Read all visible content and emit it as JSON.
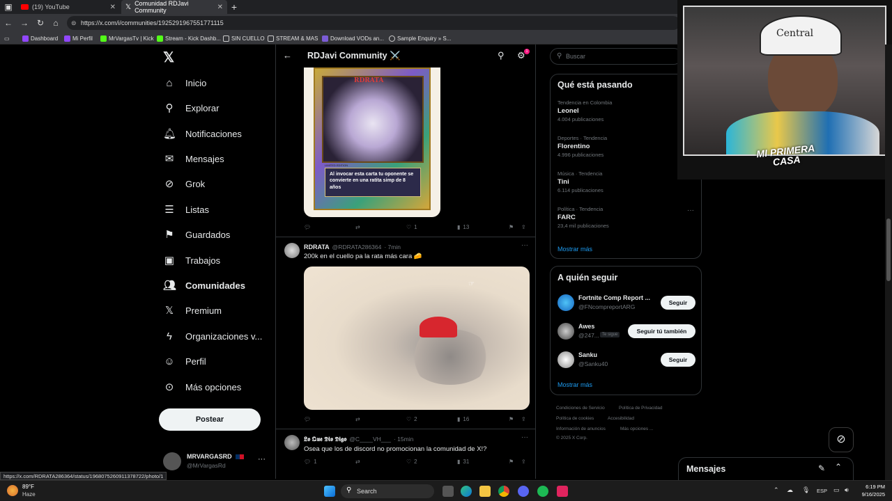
{
  "browser": {
    "tabs": [
      {
        "label": "(19) YouTube"
      },
      {
        "label": "Comunidad RDJavi Community"
      }
    ],
    "url": "https://x.com/i/communities/1925291967551771115",
    "bookmarks": [
      "Dashboard",
      "Mi Perfil",
      "MrVargasTv | Kick",
      "Stream - Kick Dashb...",
      "SIN CUELLO",
      "STREAM & MAS",
      "Download VODs an...",
      "Sample Enquiry » S..."
    ]
  },
  "nav": {
    "items": [
      {
        "label": "Inicio",
        "icon": "home-icon"
      },
      {
        "label": "Explorar",
        "icon": "search-icon"
      },
      {
        "label": "Notificaciones",
        "icon": "bell-icon"
      },
      {
        "label": "Mensajes",
        "icon": "envelope-icon"
      },
      {
        "label": "Grok",
        "icon": "grok-icon"
      },
      {
        "label": "Listas",
        "icon": "list-icon"
      },
      {
        "label": "Guardados",
        "icon": "bookmark-icon"
      },
      {
        "label": "Trabajos",
        "icon": "briefcase-icon"
      },
      {
        "label": "Comunidades",
        "icon": "people-icon"
      },
      {
        "label": "Premium",
        "icon": "x-icon"
      },
      {
        "label": "Organizaciones v...",
        "icon": "lightning-icon"
      },
      {
        "label": "Perfil",
        "icon": "person-icon"
      },
      {
        "label": "Más opciones",
        "icon": "more-circle-icon"
      }
    ],
    "post_label": "Postear",
    "account": {
      "name": "MRVARGASRD",
      "handle": "@MrVargasRd"
    }
  },
  "community": {
    "title": "RDJavi Community ⚔️",
    "notification_count": "1"
  },
  "tweets": [
    {
      "card_caption": "Al invocar esta carta tu oponente se convierte en una ratita simp de 8 años",
      "card_title": "RDRATA",
      "card_edition": "LIMITED EDITION",
      "likes": "1",
      "views": "13"
    },
    {
      "name": "RDRATA",
      "handle": "@RDRATA286364",
      "time": "· 7min",
      "text": "200k en el cuello pa la rata más cara 🧀",
      "likes": "2",
      "views": "16"
    },
    {
      "name": "𝕷𝖔 𝕼𝖚𝖊 𝕯𝖎𝖔 𝕯𝖎𝖌𝖔",
      "handle": "@C____VH___",
      "time": "· 15min",
      "text": "Osea que los de discord no promocionan la comunidad de X!?",
      "replies": "1",
      "likes": "2",
      "views": "31"
    }
  ],
  "right": {
    "search_placeholder": "Buscar",
    "trends_title": "Qué está pasando",
    "trends": [
      {
        "meta": "Tendencia en Colombia",
        "name": "Leonel",
        "count": "4.004 publicaciones"
      },
      {
        "meta": "Deportes · Tendencia",
        "name": "Florentino",
        "count": "4.996 publicaciones"
      },
      {
        "meta": "Música · Tendencia",
        "name": "Tini",
        "count": "6.114 publicaciones"
      },
      {
        "meta": "Política · Tendencia",
        "name": "FARC",
        "count": "23,4 mil publicaciones"
      }
    ],
    "show_more": "Mostrar más",
    "follow_title": "A quién seguir",
    "follow": [
      {
        "name": "Fortnite Comp Report ...",
        "handle": "@FNcompreportARG",
        "button": "Seguir"
      },
      {
        "name": "Awes",
        "handle": "@247...",
        "badge": "Te sigue",
        "button": "Seguir tú también"
      },
      {
        "name": "Sanku",
        "handle": "@Sanku40",
        "button": "Seguir"
      }
    ],
    "footer": [
      "Condiciones de Servicio",
      "Política de Privacidad",
      "Política de cookies",
      "Accesibilidad",
      "Información de anuncios",
      "Más opciones ...",
      "© 2025 X Corp."
    ]
  },
  "messages_label": "Mensajes",
  "overlay": {
    "cap_text": "Central",
    "brand_text": "MI PRIMERA CASA"
  },
  "status_link": "https://x.com/RDRATA286364/status/1968075260911378722/photo/1",
  "taskbar": {
    "weather_temp": "89°F",
    "weather_desc": "Haze",
    "search": "Search",
    "lang": "ESP",
    "time": "6:19 PM",
    "date": "9/16/2025"
  },
  "colors": {
    "accent": "#1d9bf0",
    "background": "#000000",
    "border": "#2f3336",
    "muted": "#71767b"
  }
}
